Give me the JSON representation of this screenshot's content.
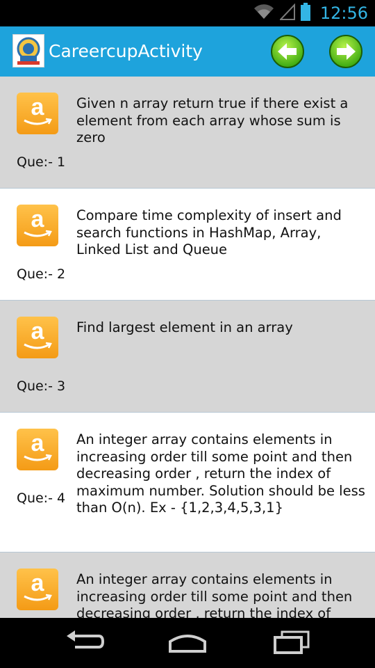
{
  "status_bar": {
    "time": "12:56",
    "icons": [
      "wifi-icon",
      "signal-icon",
      "battery-icon"
    ],
    "accent_color": "#33b5e5"
  },
  "action_bar": {
    "title": "CareercupActivity",
    "background": "#1ea3dc",
    "buttons": [
      "back-arrow-icon",
      "forward-arrow-icon"
    ]
  },
  "questions": [
    {
      "label": "Que:- 1",
      "text": "Given n array return true if there exist a element from each array whose sum is zero",
      "logo": "amazon-logo-icon"
    },
    {
      "label": "Que:- 2",
      "text": "Compare time complexity of insert and search functions in HashMap, Array, Linked List and Queue",
      "logo": "amazon-logo-icon"
    },
    {
      "label": "Que:- 3",
      "text": "Find largest element in an array",
      "logo": "amazon-logo-icon"
    },
    {
      "label": "Que:- 4",
      "text": "An integer array contains elements in increasing order till some point and then decreasing order , return the index of maximum number. Solution should be less than O(n). Ex - {1,2,3,4,5,3,1}",
      "logo": "amazon-logo-icon"
    },
    {
      "label": "",
      "text": "An integer array contains elements in increasing order till some point and then decreasing order , return the index of",
      "logo": "amazon-logo-icon"
    }
  ],
  "amazon_logo_text": "a",
  "nav_bar": {
    "buttons": [
      "back-nav-icon",
      "home-nav-icon",
      "recent-apps-icon"
    ]
  }
}
